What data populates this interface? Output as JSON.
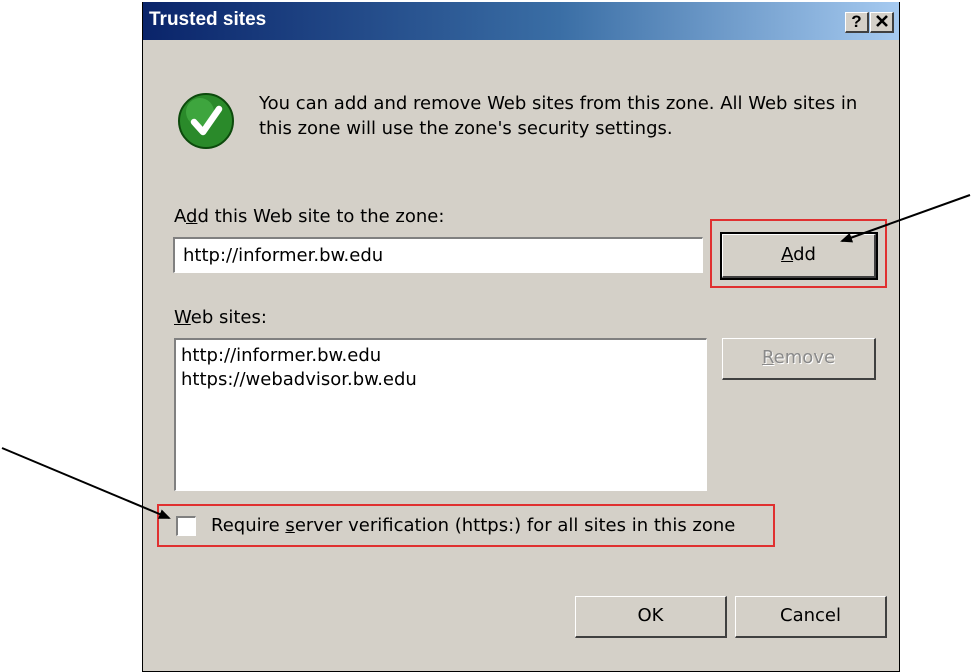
{
  "dialog": {
    "title": "Trusted sites",
    "help_glyph": "?",
    "close_glyph": "✕",
    "icon": "check-circle-icon",
    "description": "You can add and remove Web sites from this zone. All Web sites in this zone will use the zone's security settings."
  },
  "add_section": {
    "label_pre": "A",
    "label_underlined": "d",
    "label_post": "d this Web site to the zone:",
    "input_value": "http://informer.bw.edu",
    "add_button_underlined": "A",
    "add_button_rest": "dd"
  },
  "sites_section": {
    "label_underlined": "W",
    "label_rest": "eb sites:",
    "items": [
      "http://informer.bw.edu",
      "https://webadvisor.bw.edu"
    ],
    "remove_button_underlined": "R",
    "remove_button_rest": "emove"
  },
  "verification": {
    "checked": false,
    "label_pre": "Require ",
    "label_underlined": "s",
    "label_post": "erver verification (https:) for all sites in this zone"
  },
  "footer": {
    "ok_label": "OK",
    "cancel_label": "Cancel"
  },
  "annotation_colors": {
    "highlight": "#e03030",
    "arrow": "#000000"
  }
}
